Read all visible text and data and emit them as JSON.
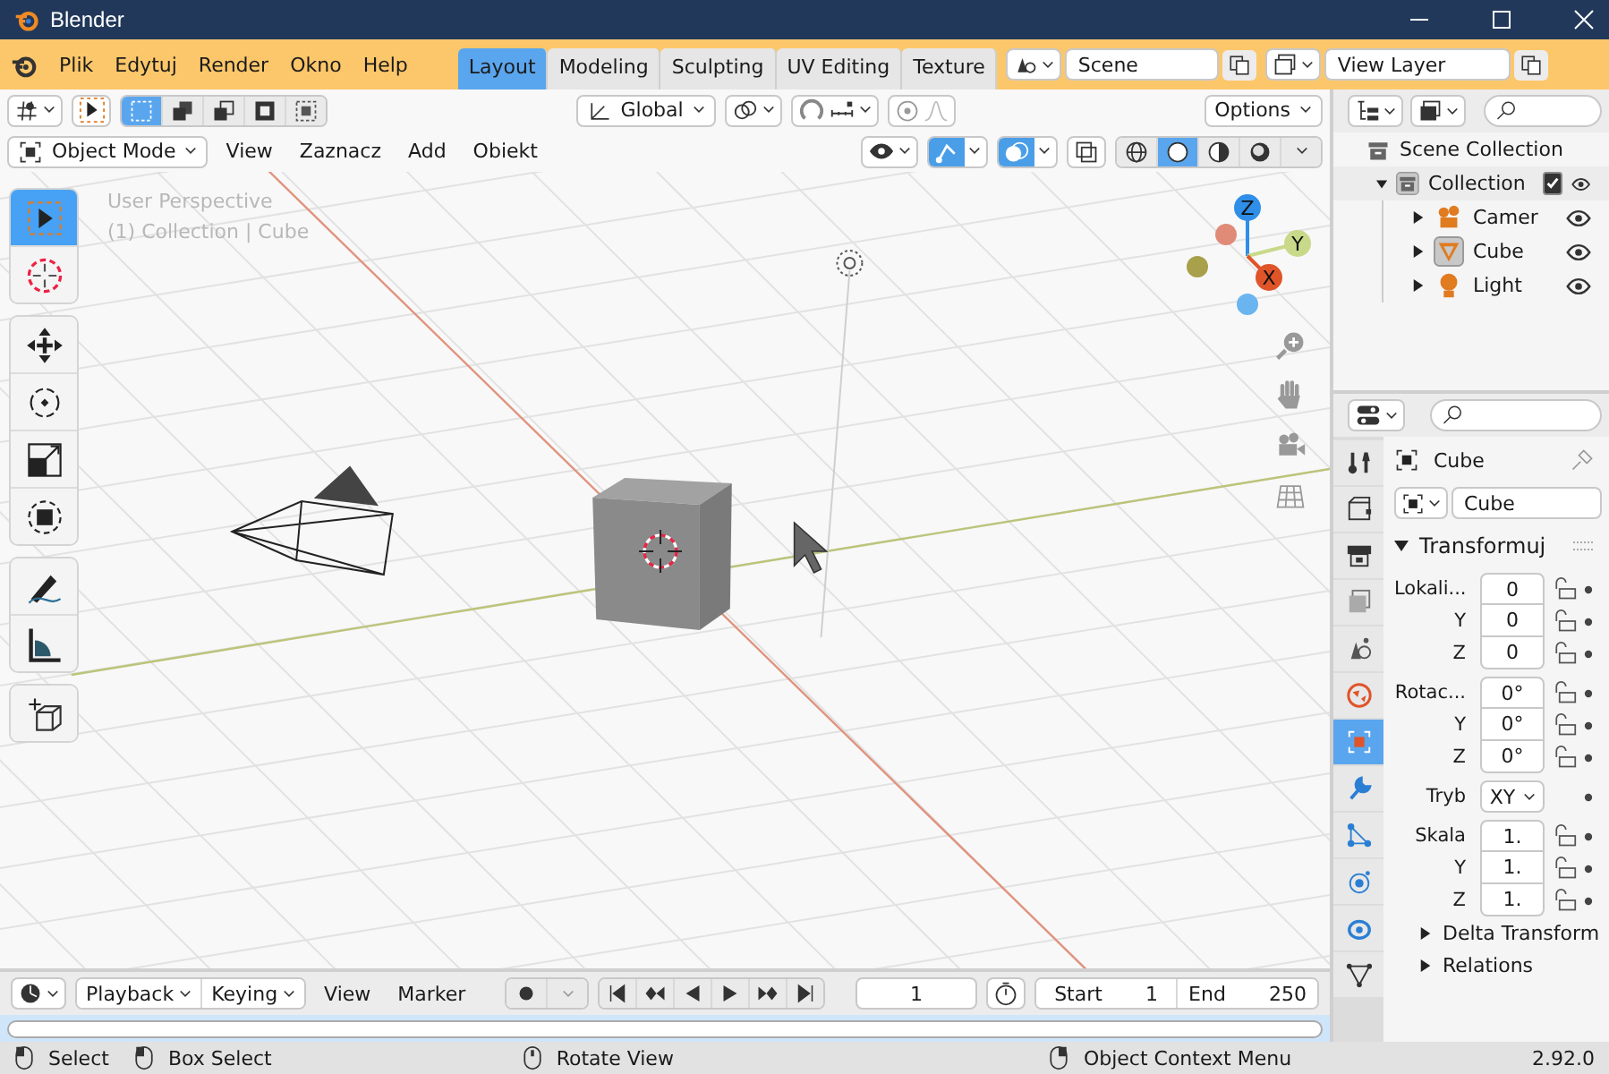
{
  "window": {
    "title": "Blender"
  },
  "menu": [
    "Plik",
    "Edytuj",
    "Render",
    "Okno",
    "Help"
  ],
  "workspace_tabs": [
    {
      "label": "Layout",
      "selected": true
    },
    {
      "label": "Modeling",
      "selected": false
    },
    {
      "label": "Sculpting",
      "selected": false
    },
    {
      "label": "UV Editing",
      "selected": false
    },
    {
      "label": "Texture",
      "selected": false
    }
  ],
  "scene": {
    "value": "Scene"
  },
  "view_layer": {
    "value": "View Layer"
  },
  "tool_settings": {
    "select_modes": [
      {
        "selected": true
      },
      {
        "selected": false
      },
      {
        "selected": false
      },
      {
        "selected": false
      },
      {
        "selected": false
      }
    ],
    "orientation": "Global",
    "options": "Options"
  },
  "viewport_header": {
    "mode": "Object Mode",
    "menus": [
      "View",
      "Zaznacz",
      "Add",
      "Obiekt"
    ],
    "toggles": [
      {
        "kind": "gizmo",
        "on": true
      },
      {
        "kind": "overlay",
        "on": true
      },
      {
        "kind": "xray",
        "on": false
      }
    ],
    "shading": [
      {
        "kind": "wireframe",
        "selected": false
      },
      {
        "kind": "solid",
        "selected": true
      },
      {
        "kind": "material",
        "selected": false
      },
      {
        "kind": "rendered",
        "selected": false
      }
    ]
  },
  "viewport": {
    "overlay_lines": [
      "User Perspective",
      "(1) Collection | Cube"
    ],
    "tools": [
      {
        "kind": "select",
        "selected": true
      },
      {
        "kind": "cursor",
        "selected": false
      },
      {
        "kind": "move",
        "selected": false
      },
      {
        "kind": "rotate",
        "selected": false
      },
      {
        "kind": "scale",
        "selected": false
      },
      {
        "kind": "transform",
        "selected": false
      },
      {
        "kind": "annotate",
        "selected": false
      },
      {
        "kind": "measure",
        "selected": false
      },
      {
        "kind": "add_cube",
        "selected": false
      }
    ],
    "gizmo_axes": [
      "Z",
      "Y",
      "X"
    ]
  },
  "outliner": {
    "root": {
      "label": "Scene Collection",
      "children": [
        {
          "label": "Collection",
          "expanded": true,
          "active": true,
          "checked": true,
          "visible": true,
          "children": [
            {
              "label": "Camer",
              "kind": "camera",
              "expanded": false,
              "selected": false,
              "visible": true
            },
            {
              "label": "Cube",
              "kind": "mesh",
              "expanded": false,
              "selected": true,
              "visible": true
            },
            {
              "label": "Light",
              "kind": "light",
              "expanded": false,
              "selected": false,
              "visible": true
            }
          ]
        }
      ]
    }
  },
  "properties": {
    "tabs": [
      {
        "kind": "tool",
        "selected": false
      },
      {
        "kind": "render",
        "selected": false
      },
      {
        "kind": "output",
        "selected": false
      },
      {
        "kind": "view_layer",
        "selected": false
      },
      {
        "kind": "scene",
        "selected": false
      },
      {
        "kind": "world",
        "selected": false
      },
      {
        "kind": "object",
        "selected": true
      },
      {
        "kind": "modifiers",
        "selected": false
      },
      {
        "kind": "particles",
        "selected": false
      },
      {
        "kind": "physics",
        "selected": false
      },
      {
        "kind": "constraints",
        "selected": false
      },
      {
        "kind": "data",
        "selected": false
      }
    ],
    "object_name": "Cube",
    "data_name": "Cube",
    "panel": {
      "title": "Transformuj",
      "expanded": true
    },
    "rows": [
      {
        "kind": "value",
        "label": "Lokali...",
        "value": "0",
        "group_start": true
      },
      {
        "kind": "value",
        "label": "Y",
        "value": "0",
        "group_start": false
      },
      {
        "kind": "value",
        "label": "Z",
        "value": "0",
        "group_start": false
      },
      {
        "kind": "value",
        "label": "Rotac...",
        "value": "0°",
        "group_start": true
      },
      {
        "kind": "value",
        "label": "Y",
        "value": "0°",
        "group_start": false
      },
      {
        "kind": "value",
        "label": "Z",
        "value": "0°",
        "group_start": false
      },
      {
        "kind": "dropdown",
        "label": "Tryb",
        "value": "XY",
        "group_start": true
      },
      {
        "kind": "value",
        "label": "Skala",
        "value": "1.",
        "group_start": true
      },
      {
        "kind": "value",
        "label": "Y",
        "value": "1.",
        "group_start": false
      },
      {
        "kind": "value",
        "label": "Z",
        "value": "1.",
        "group_start": false
      }
    ],
    "subpanels": [
      {
        "title": "Delta Transform",
        "expanded": false
      },
      {
        "title": "Relations",
        "expanded": false
      }
    ]
  },
  "timeline": {
    "playback": "Playback",
    "keying": "Keying",
    "menus": [
      "View",
      "Marker"
    ],
    "current_frame": "1",
    "start_label": "Start",
    "start": "1",
    "end_label": "End",
    "end": "250"
  },
  "status_bar": {
    "items": [
      {
        "kind": "left_click",
        "label": "Select"
      },
      {
        "kind": "left_drag",
        "label": "Box Select"
      },
      {
        "kind": "middle_click",
        "label": "Rotate View"
      },
      {
        "kind": "right_click",
        "label": "Object Context Menu"
      }
    ],
    "version": "2.92.0"
  }
}
